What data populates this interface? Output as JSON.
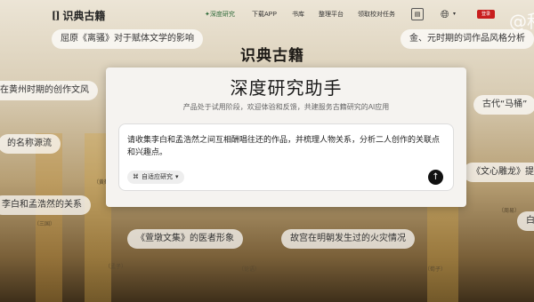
{
  "header": {
    "logo_mark": "[]",
    "logo_text": "识典古籍",
    "nav": [
      {
        "label": "深度研究",
        "active": true,
        "icon": "sparkle-icon"
      },
      {
        "label": "下载APP",
        "active": false
      },
      {
        "label": "书库",
        "active": false
      },
      {
        "label": "整理平台",
        "active": false
      },
      {
        "label": "领取校对任务",
        "active": false
      }
    ],
    "red_button": "登录",
    "watermark": "@科"
  },
  "hero_title": "识典古籍",
  "pills": [
    "屈原《离骚》对于赋体文学的影响",
    "金、元时期的词作品风格分析",
    "在黄州时期的创作文风",
    "古代“马桶”",
    "的名称源流",
    "《文心雕龙》提到",
    "李白和孟浩然的关系",
    "白",
    "《萱墩文集》的医者形象",
    "故宫在明朝发生过的火灾情况"
  ],
  "modal": {
    "title": "深度研究助手",
    "subtitle": "产品处于试用阶段，欢迎体验和反馈，共建服务古籍研究的AI应用",
    "query": "请收集李白和孟浩然之间互相酬唱往还的作品，并梳理人物关系，分析二人创作的关联点和兴趣点。",
    "mode_label": "自适应研究",
    "mode_icon": "research-icon",
    "send_icon": "send-arrow-icon"
  },
  "book_captions": [
    "（黄鹤楼）",
    "（孟子）",
    "（论语）",
    "（荀子）",
    "（三国）",
    "（周易）"
  ]
}
